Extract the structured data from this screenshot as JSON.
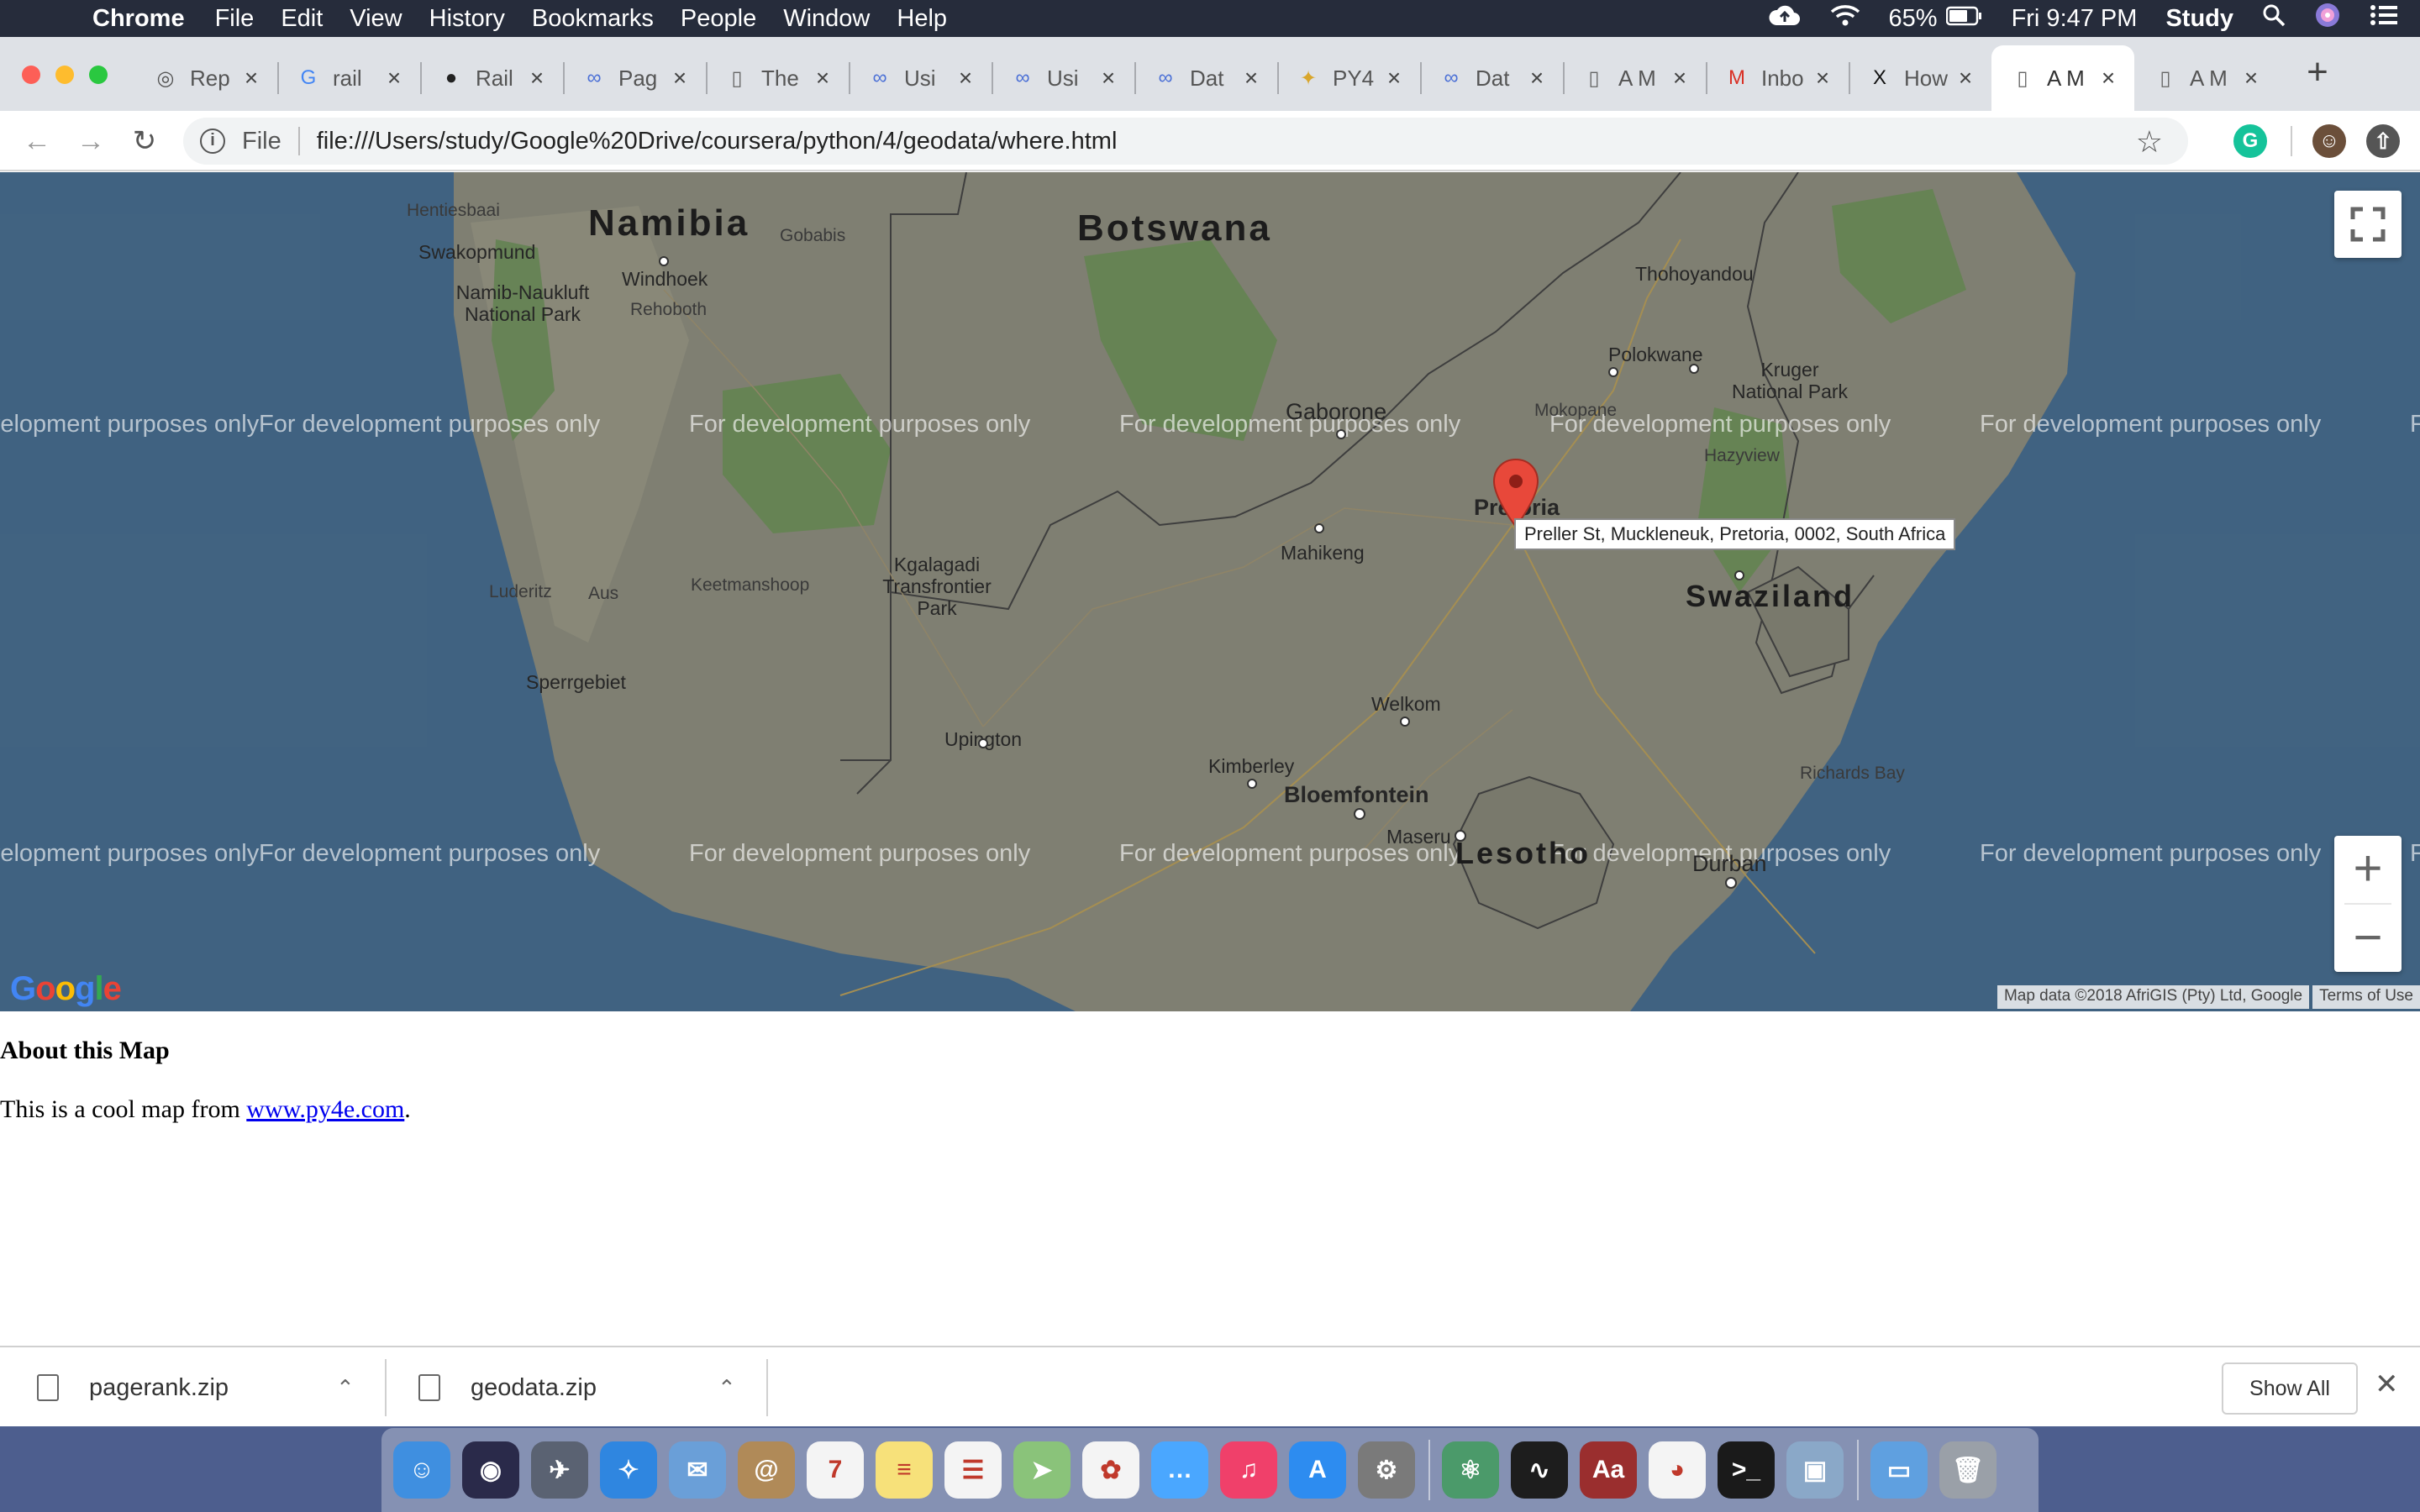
{
  "menubar": {
    "apple": "",
    "items": [
      "Chrome",
      "File",
      "Edit",
      "View",
      "History",
      "Bookmarks",
      "People",
      "Window",
      "Help"
    ],
    "battery": "65%",
    "clock": "Fri 9:47 PM",
    "user": "Study"
  },
  "tabs": [
    {
      "title": "Rep",
      "icon": "spiral-icon",
      "color": "#555555",
      "glyph": "◎"
    },
    {
      "title": "rail",
      "icon": "google-icon",
      "color": "#4285f4",
      "glyph": "G"
    },
    {
      "title": "Rail",
      "icon": "github-icon",
      "color": "#222222",
      "glyph": "●"
    },
    {
      "title": "Pag",
      "icon": "infinity-icon",
      "color": "#4a6fd6",
      "glyph": "∞"
    },
    {
      "title": "The",
      "icon": "document-icon",
      "color": "#666666",
      "glyph": "▯"
    },
    {
      "title": "Usi",
      "icon": "infinity-icon",
      "color": "#4a6fd6",
      "glyph": "∞"
    },
    {
      "title": "Usi",
      "icon": "infinity-icon",
      "color": "#4a6fd6",
      "glyph": "∞"
    },
    {
      "title": "Dat",
      "icon": "infinity-icon",
      "color": "#4a6fd6",
      "glyph": "∞"
    },
    {
      "title": "PY4",
      "icon": "python-icon",
      "color": "#d9a62b",
      "glyph": "✦"
    },
    {
      "title": "Dat",
      "icon": "infinity-icon",
      "color": "#4a6fd6",
      "glyph": "∞"
    },
    {
      "title": "A M",
      "icon": "document-icon",
      "color": "#666666",
      "glyph": "▯"
    },
    {
      "title": "Inbo",
      "icon": "gmail-icon",
      "color": "#d93025",
      "glyph": "M"
    },
    {
      "title": "How",
      "icon": "x-logo-icon",
      "color": "#111111",
      "glyph": "X"
    },
    {
      "title": "A M",
      "icon": "document-icon",
      "color": "#666666",
      "glyph": "▯",
      "active": true
    },
    {
      "title": "A M",
      "icon": "document-icon",
      "color": "#666666",
      "glyph": "▯"
    }
  ],
  "toolbar": {
    "scheme": "File",
    "url": "file:///Users/study/Google%20Drive/coursera/python/4/geodata/where.html"
  },
  "map": {
    "watermark": "For development purposes only",
    "tooltip": "Preller St, Muckleneuk, Pretoria, 0002, South Africa",
    "countries": [
      "Namibia",
      "Botswana",
      "Swaziland",
      "Lesotho"
    ],
    "cities": [
      "Hentiesbaai",
      "Swakopmund",
      "Windhoek",
      "Gobabis",
      "Namib-Naukluft National Park",
      "Rehoboth",
      "Thohoyandou",
      "Polokwane",
      "Kruger National Park",
      "Mokopane",
      "Gaborone",
      "Hazyview",
      "Pretoria",
      "Mahikeng",
      "Kgalagadi Transfrontier Park",
      "Keetmanshoop",
      "Luderitz",
      "Aus",
      "Sperrgebiet",
      "Welkom",
      "Upington",
      "Kimberley",
      "Richards Bay",
      "Bloemfontein",
      "Maseru",
      "Durban"
    ],
    "google_logo": "Google",
    "attribution": "Map data ©2018 AfriGIS (Pty) Ltd, Google",
    "terms": "Terms of Use",
    "colors": {
      "ocean": "#466b8c",
      "land": "#8a8a7c",
      "parks": "#6f8f5c"
    }
  },
  "page": {
    "heading": "About this Map",
    "text_before": "This is a cool map from ",
    "link": "www.py4e.com",
    "text_after": "."
  },
  "downloads": {
    "items": [
      "pagerank.zip",
      "geodata.zip"
    ],
    "show_all": "Show All"
  },
  "dock": {
    "apps": [
      {
        "name": "finder-icon",
        "color": "#3f8fe0",
        "glyph": "☺"
      },
      {
        "name": "siri-icon",
        "color": "#2a2a4a",
        "glyph": "◉"
      },
      {
        "name": "launchpad-icon",
        "color": "#5a6272",
        "glyph": "✈"
      },
      {
        "name": "safari-icon",
        "color": "#2f86e0",
        "glyph": "✧"
      },
      {
        "name": "mail-icon",
        "color": "#6a9fd8",
        "glyph": "✉"
      },
      {
        "name": "contacts-icon",
        "color": "#b08a58",
        "glyph": "@"
      },
      {
        "name": "calendar-icon",
        "color": "#f4f4f4",
        "glyph": "7"
      },
      {
        "name": "notes-icon",
        "color": "#f7e17a",
        "glyph": "≡"
      },
      {
        "name": "reminders-icon",
        "color": "#f4f4f4",
        "glyph": "☰"
      },
      {
        "name": "maps-icon",
        "color": "#8ac37a",
        "glyph": "➤"
      },
      {
        "name": "photos-icon",
        "color": "#f4f4f4",
        "glyph": "✿"
      },
      {
        "name": "messages-icon",
        "color": "#4aa7ff",
        "glyph": "…"
      },
      {
        "name": "itunes-icon",
        "color": "#f0406a",
        "glyph": "♫"
      },
      {
        "name": "app-store-icon",
        "color": "#2d8cf0",
        "glyph": "A"
      },
      {
        "name": "system-preferences-icon",
        "color": "#7a7a7a",
        "glyph": "⚙"
      },
      {
        "name": "atom-icon",
        "color": "#4b9a6a",
        "glyph": "⚛"
      },
      {
        "name": "activity-monitor-icon",
        "color": "#1d1d1d",
        "glyph": "∿"
      },
      {
        "name": "dictionary-icon",
        "color": "#9a2e2e",
        "glyph": "Aa"
      },
      {
        "name": "chrome-icon",
        "color": "#f4f4f4",
        "glyph": "◕"
      },
      {
        "name": "terminal-icon",
        "color": "#1a1a1a",
        "glyph": ">_"
      },
      {
        "name": "preview-icon",
        "color": "#8aa8c8",
        "glyph": "▣"
      },
      {
        "name": "folder-icon",
        "color": "#5fa0e0",
        "glyph": "▭"
      },
      {
        "name": "trash-icon",
        "color": "#9aa0a8",
        "glyph": "🗑"
      }
    ]
  }
}
